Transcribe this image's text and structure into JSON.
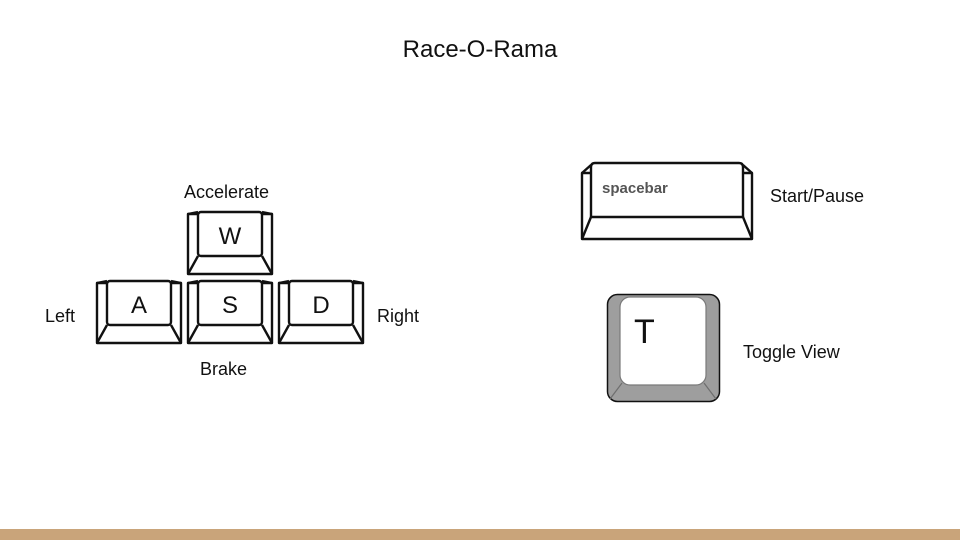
{
  "title": "Race-O-Rama",
  "keys": {
    "w": {
      "letter": "W",
      "action": "Accelerate"
    },
    "a": {
      "letter": "A",
      "action": "Left"
    },
    "s": {
      "letter": "S",
      "action": "Brake"
    },
    "d": {
      "letter": "D",
      "action": "Right"
    },
    "space": {
      "letter": "spacebar",
      "action": "Start/Pause"
    },
    "t": {
      "letter": "T",
      "action": "Toggle View"
    }
  },
  "colors": {
    "accent_bar": "#c9a47a",
    "t_key_frame": "#9e9e9e"
  },
  "icons": {
    "w": "w-key-icon",
    "a": "a-key-icon",
    "s": "s-key-icon",
    "d": "d-key-icon",
    "space": "spacebar-key-icon",
    "t": "t-key-icon"
  }
}
